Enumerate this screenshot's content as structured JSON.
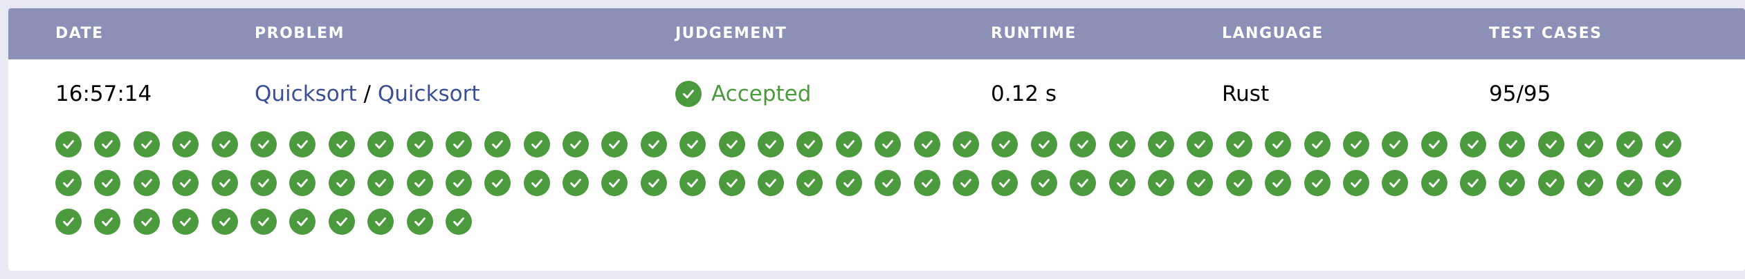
{
  "header": {
    "date": "DATE",
    "problem": "PROBLEM",
    "judgement": "JUDGEMENT",
    "runtime": "RUNTIME",
    "language": "LANGUAGE",
    "test_cases": "TEST CASES"
  },
  "submission": {
    "date": "16:57:14",
    "problem_part1": "Quicksort",
    "problem_separator": "/",
    "problem_part2": "Quicksort",
    "judgement": "Accepted",
    "runtime": "0.12 s",
    "language": "Rust",
    "test_cases": "95/95"
  },
  "test_results": {
    "total": 95,
    "passed": 95,
    "status_icon": "check-circle-icon",
    "color": "#4b9a3d"
  },
  "colors": {
    "header_bg": "#8c90b6",
    "link": "#3a4f94",
    "accepted": "#4b9a3d",
    "page_bg": "#e9e9f3"
  }
}
